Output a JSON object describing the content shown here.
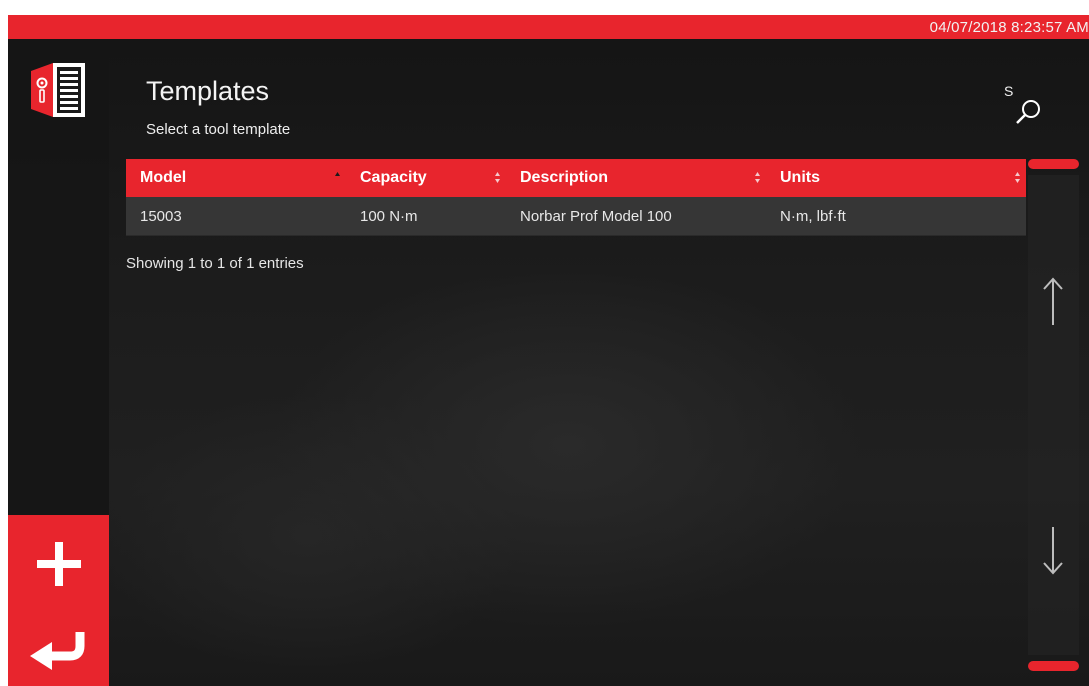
{
  "status_bar": {
    "datetime": "04/07/2018 8:23:57 AM",
    "color": "#e8252d"
  },
  "header": {
    "title": "Templates",
    "subtitle": "Select a tool template",
    "search_label": "S",
    "search_icon": "search-icon"
  },
  "sidebar": {
    "logo_icon": "template-book-icon",
    "add_icon": "plus-icon",
    "back_icon": "return-arrow-icon"
  },
  "table": {
    "columns": [
      {
        "label": "Model",
        "sort": "ascending"
      },
      {
        "label": "Capacity",
        "sort": "none"
      },
      {
        "label": "Description",
        "sort": "none"
      },
      {
        "label": "Units",
        "sort": "none"
      }
    ],
    "rows": [
      {
        "model": "15003",
        "capacity": "100 N·m",
        "description": "Norbar Prof Model 100",
        "units": "N·m, lbf·ft"
      }
    ],
    "info": "Showing 1 to 1 of 1 entries"
  },
  "scrollbar": {
    "up_icon": "arrow-up-icon",
    "down_icon": "arrow-down-icon"
  }
}
